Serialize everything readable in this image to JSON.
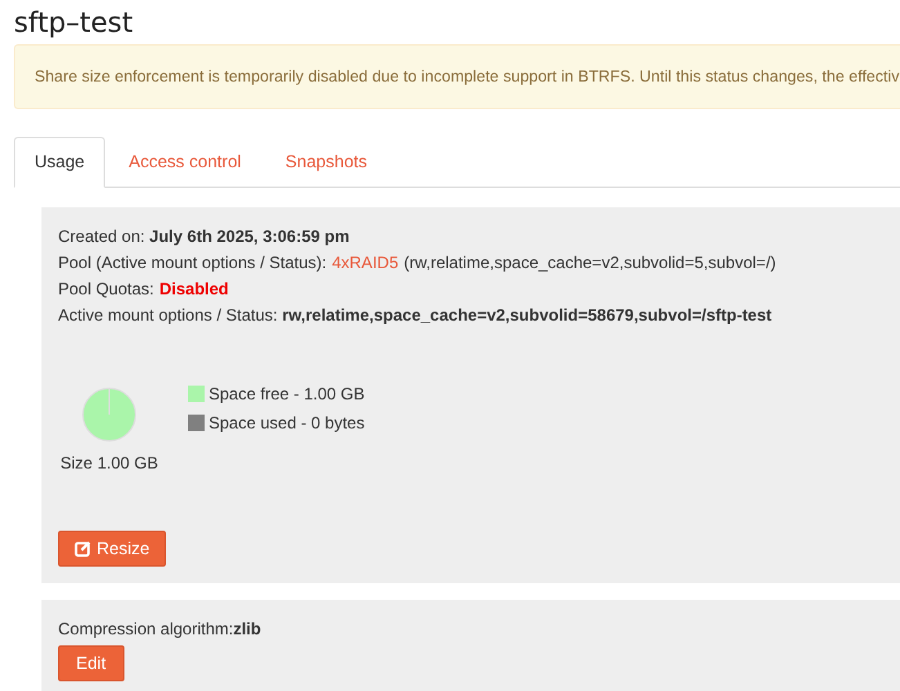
{
  "title": "sftp–test",
  "alert": "Share size enforcement is temporarily disabled due to incomplete support in BTRFS. Until this status changes, the effectiv",
  "tabs": [
    {
      "label": "Usage",
      "selected": true
    },
    {
      "label": "Access control",
      "selected": false
    },
    {
      "label": "Snapshots",
      "selected": false
    }
  ],
  "details": [
    {
      "kind": "plain",
      "text": "Created on: **July 6th 2025, 3:06:59 pm**"
    },
    {
      "kind": "pool",
      "label": "Pool (Active mount options / Status):",
      "link": "4xRAID5",
      "rest": "(rw,relatime,space_cache=v2,subvolid=5,subvol=/)"
    },
    {
      "kind": "quota",
      "label": "Pool Quotas:",
      "value": "Disabled"
    },
    {
      "kind": "plain",
      "text": "Active mount options / Status: **rw,relatime,space_cache=v2,subvolid=58679,subvol=/sftp-test**"
    }
  ],
  "usage": {
    "size": "Size 1.00 GB",
    "legend": [
      {
        "label": "Space free - 1.00 GB",
        "color": "#aaf5aa"
      },
      {
        "label": "Space used - 0 bytes",
        "color": "#808080"
      }
    ],
    "resize_button": "Resize"
  },
  "compression": {
    "text": "Compression algorithm:**zlib**",
    "edit_button": "Edit"
  }
}
